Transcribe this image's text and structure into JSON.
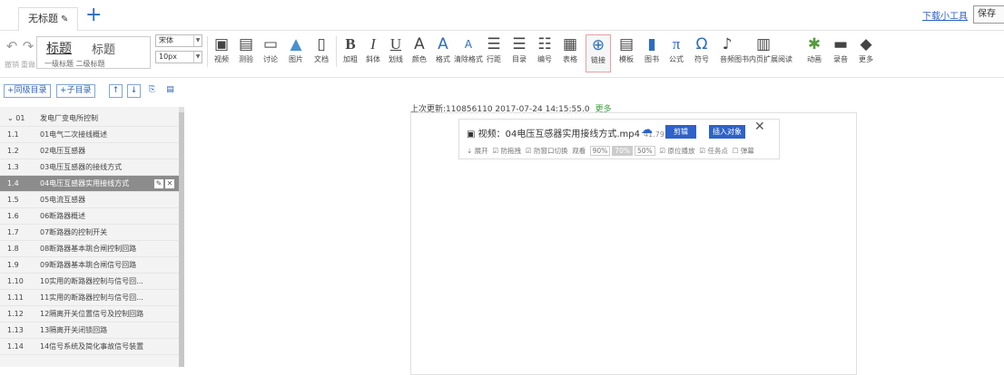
{
  "tab": {
    "title": "无标题"
  },
  "header": {
    "download_link": "下载小工具",
    "save_label": "保存"
  },
  "undo": {
    "undo_label": "撤销",
    "redo_label": "重做"
  },
  "title_styles": {
    "h1": "标题",
    "h2": "标题",
    "h1_sub": "一级标题",
    "h2_sub": "二级标题"
  },
  "font": {
    "family_value": "宋体",
    "size_value": "10px"
  },
  "tools": [
    {
      "label": "视频",
      "icon": "video-icon"
    },
    {
      "label": "测验",
      "icon": "quiz-icon"
    },
    {
      "label": "讨论",
      "icon": "discussion-icon"
    },
    {
      "label": "图片",
      "icon": "image-icon"
    },
    {
      "label": "文档",
      "icon": "document-icon"
    },
    {
      "label": "加粗",
      "icon": "bold-icon"
    },
    {
      "label": "斜体",
      "icon": "italic-icon"
    },
    {
      "label": "划线",
      "icon": "underline-icon"
    },
    {
      "label": "颜色",
      "icon": "font-color-icon"
    },
    {
      "label": "格式",
      "icon": "format-icon"
    },
    {
      "label": "清除格式",
      "icon": "clear-format-icon"
    },
    {
      "label": "行距",
      "icon": "line-spacing-icon"
    },
    {
      "label": "目录",
      "icon": "list-icon"
    },
    {
      "label": "编号",
      "icon": "numbering-icon"
    },
    {
      "label": "表格",
      "icon": "table-icon"
    },
    {
      "label": "链接",
      "icon": "link-icon"
    },
    {
      "label": "模板",
      "icon": "template-icon"
    },
    {
      "label": "图书",
      "icon": "book-icon"
    },
    {
      "label": "公式",
      "icon": "formula-icon"
    },
    {
      "label": "符号",
      "icon": "symbol-icon"
    },
    {
      "label": "音频",
      "icon": "audio-icon"
    },
    {
      "label": "图书内页扩展阅读",
      "icon": "extended-reading-icon"
    },
    {
      "label": "动画",
      "icon": "animation-icon"
    },
    {
      "label": "录音",
      "icon": "record-icon"
    },
    {
      "label": "更多",
      "icon": "more-icon"
    }
  ],
  "outline_buttons": {
    "add_sibling": "+同级目录",
    "add_child": "+子目录"
  },
  "outline": [
    {
      "num": "01",
      "title": "发电厂变电所控制"
    },
    {
      "num": "1.1",
      "title": "01电气二次接线概述"
    },
    {
      "num": "1.2",
      "title": "02电压互感器"
    },
    {
      "num": "1.3",
      "title": "03电压互感器的接线方式"
    },
    {
      "num": "1.4",
      "title": "04电压互感器实用接线方式"
    },
    {
      "num": "1.5",
      "title": "05电流互感器"
    },
    {
      "num": "1.6",
      "title": "06断路器概述"
    },
    {
      "num": "1.7",
      "title": "07断路器的控制开关"
    },
    {
      "num": "1.8",
      "title": "08断路器基本跳合闸控制回路"
    },
    {
      "num": "1.9",
      "title": "09断路器基本跳合闸信号回路"
    },
    {
      "num": "1.10",
      "title": "10实用的断路器控制与信号回..."
    },
    {
      "num": "1.11",
      "title": "11实用的断路器控制与信号回..."
    },
    {
      "num": "1.12",
      "title": "12隔离开关位置信号及控制回路"
    },
    {
      "num": "1.13",
      "title": "13隔离开关闭锁回路"
    },
    {
      "num": "1.14",
      "title": "14信号系统及简化事故信号装置"
    }
  ],
  "editor": {
    "last_update": "上次更新:110856110 2017-07-24 14:15:55.0",
    "more_link": "更多"
  },
  "video": {
    "title": "视频：04电压互感器实用接线方式.mp4",
    "size": "41.79 MB",
    "cut_label": "剪辑",
    "insert_label": "插入对象",
    "opt_expand": "展开",
    "opt_antidrag": "防拖拽",
    "opt_antiswitch": "防窗口切换",
    "opt_watch": "观看",
    "pct1": "90%",
    "pct2": "70%",
    "pct3": "50%",
    "opt_origin": "原位播放",
    "opt_task": "任务点",
    "opt_danmu": "弹幕"
  }
}
